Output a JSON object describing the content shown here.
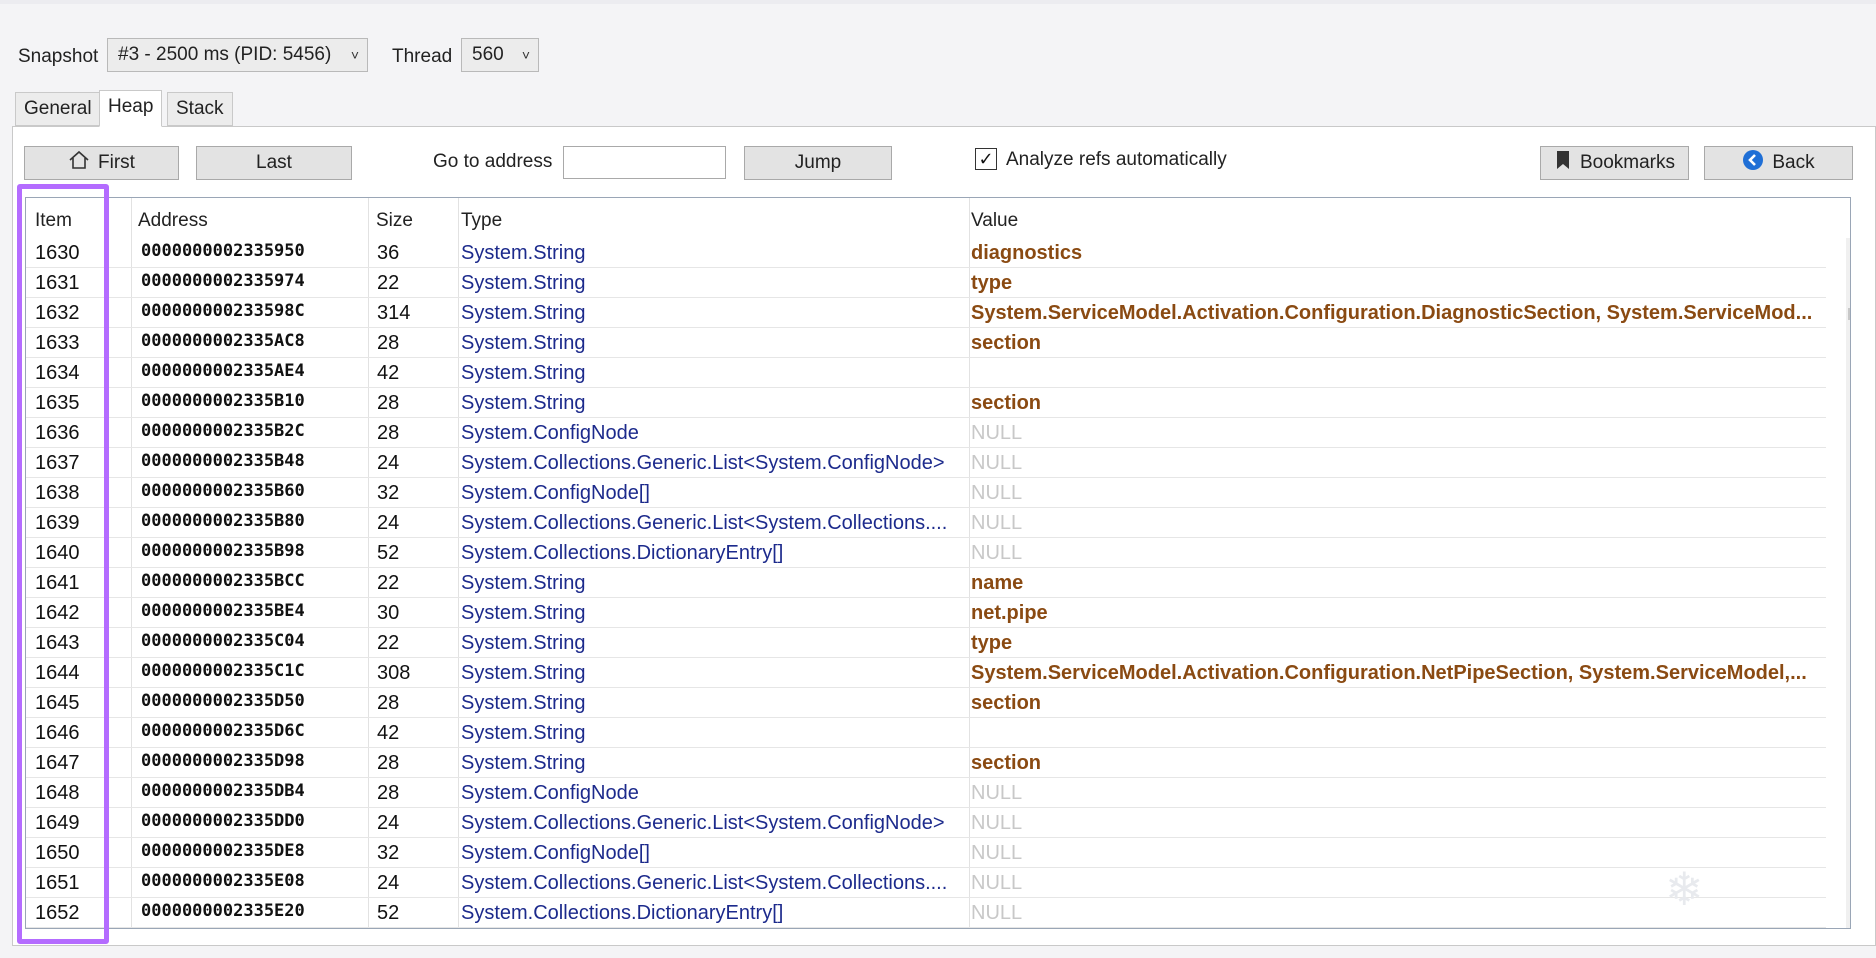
{
  "snapshot": {
    "label": "Snapshot",
    "value": "#3 - 2500 ms (PID: 5456)"
  },
  "thread": {
    "label": "Thread",
    "value": "560"
  },
  "tabs": [
    {
      "label": "General"
    },
    {
      "label": "Heap",
      "active": true
    },
    {
      "label": "Stack"
    }
  ],
  "toolbar": {
    "first": "First",
    "last": "Last",
    "goto_label": "Go to address",
    "goto_value": "",
    "jump": "Jump",
    "analyze_label": "Analyze refs automatically",
    "analyze_checked": true,
    "bookmarks": "Bookmarks",
    "back": "Back"
  },
  "grid": {
    "columns": [
      "Item",
      "Address",
      "Size",
      "Type",
      "Value"
    ],
    "rows": [
      {
        "item": "1630",
        "address": "0000000002335950",
        "size": "36",
        "type": "System.String",
        "value": "diagnostics"
      },
      {
        "item": "1631",
        "address": "0000000002335974",
        "size": "22",
        "type": "System.String",
        "value": "type"
      },
      {
        "item": "1632",
        "address": "000000000233598C",
        "size": "314",
        "type": "System.String",
        "value": "System.ServiceModel.Activation.Configuration.DiagnosticSection, System.ServiceMod..."
      },
      {
        "item": "1633",
        "address": "0000000002335AC8",
        "size": "28",
        "type": "System.String",
        "value": "section"
      },
      {
        "item": "1634",
        "address": "0000000002335AE4",
        "size": "42",
        "type": "System.String",
        "value": ""
      },
      {
        "item": "1635",
        "address": "0000000002335B10",
        "size": "28",
        "type": "System.String",
        "value": "section"
      },
      {
        "item": "1636",
        "address": "0000000002335B2C",
        "size": "28",
        "type": "System.ConfigNode",
        "value": "NULL"
      },
      {
        "item": "1637",
        "address": "0000000002335B48",
        "size": "24",
        "type": "System.Collections.Generic.List<System.ConfigNode>",
        "value": "NULL"
      },
      {
        "item": "1638",
        "address": "0000000002335B60",
        "size": "32",
        "type": "System.ConfigNode[]",
        "value": "NULL"
      },
      {
        "item": "1639",
        "address": "0000000002335B80",
        "size": "24",
        "type": "System.Collections.Generic.List<System.Collections....",
        "value": "NULL"
      },
      {
        "item": "1640",
        "address": "0000000002335B98",
        "size": "52",
        "type": "System.Collections.DictionaryEntry[]",
        "value": "NULL"
      },
      {
        "item": "1641",
        "address": "0000000002335BCC",
        "size": "22",
        "type": "System.String",
        "value": "name"
      },
      {
        "item": "1642",
        "address": "0000000002335BE4",
        "size": "30",
        "type": "System.String",
        "value": "net.pipe"
      },
      {
        "item": "1643",
        "address": "0000000002335C04",
        "size": "22",
        "type": "System.String",
        "value": "type"
      },
      {
        "item": "1644",
        "address": "0000000002335C1C",
        "size": "308",
        "type": "System.String",
        "value": "System.ServiceModel.Activation.Configuration.NetPipeSection, System.ServiceModel,..."
      },
      {
        "item": "1645",
        "address": "0000000002335D50",
        "size": "28",
        "type": "System.String",
        "value": "section"
      },
      {
        "item": "1646",
        "address": "0000000002335D6C",
        "size": "42",
        "type": "System.String",
        "value": ""
      },
      {
        "item": "1647",
        "address": "0000000002335D98",
        "size": "28",
        "type": "System.String",
        "value": "section"
      },
      {
        "item": "1648",
        "address": "0000000002335DB4",
        "size": "28",
        "type": "System.ConfigNode",
        "value": "NULL"
      },
      {
        "item": "1649",
        "address": "0000000002335DD0",
        "size": "24",
        "type": "System.Collections.Generic.List<System.ConfigNode>",
        "value": "NULL"
      },
      {
        "item": "1650",
        "address": "0000000002335DE8",
        "size": "32",
        "type": "System.ConfigNode[]",
        "value": "NULL"
      },
      {
        "item": "1651",
        "address": "0000000002335E08",
        "size": "24",
        "type": "System.Collections.Generic.List<System.Collections....",
        "value": "NULL"
      },
      {
        "item": "1652",
        "address": "0000000002335E20",
        "size": "52",
        "type": "System.Collections.DictionaryEntry[]",
        "value": "NULL"
      }
    ]
  },
  "colors": {
    "highlight": "#b46cff",
    "type_text": "#1c2a8c",
    "value_text": "#8a4a12",
    "null_text": "#c8c8c8"
  },
  "icons": {
    "first": "home-icon",
    "bookmarks": "bookmark-icon",
    "back": "back-arrow-icon",
    "dropdown": "chevron-down-icon"
  }
}
